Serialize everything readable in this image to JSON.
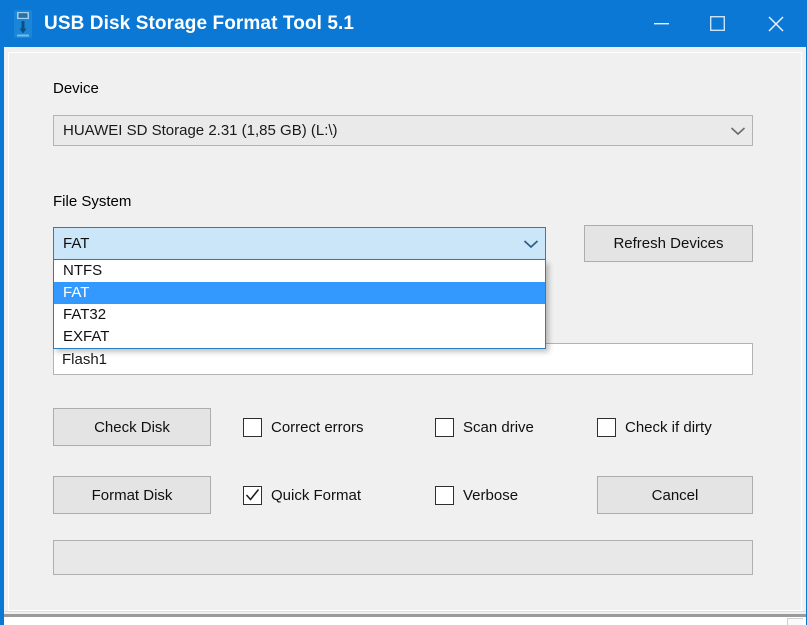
{
  "window": {
    "title": "USB Disk Storage Format Tool 5.1",
    "icon": "usb-drive-icon",
    "accent_color": "#0a78d4",
    "client_bg": "#f0f0f0",
    "controls": {
      "minimize": "minimize-icon",
      "maximize": "maximize-icon",
      "close": "close-icon"
    }
  },
  "form": {
    "device": {
      "label": "Device",
      "value": "HUAWEI  SD Storage  2.31 (1,85 GB) (L:\\)",
      "chevron": "chevron-down-icon"
    },
    "file_system": {
      "label": "File System",
      "value": "FAT",
      "chevron": "chevron-down-icon",
      "expanded": true,
      "options": [
        "NTFS",
        "FAT",
        "FAT32",
        "EXFAT"
      ],
      "selected_index": 1
    },
    "volume_label": {
      "value": "Flash1"
    },
    "refresh_button": "Refresh Devices",
    "check_row": {
      "button": "Check Disk",
      "checkboxes": [
        {
          "label": "Correct errors",
          "checked": false
        },
        {
          "label": "Scan drive",
          "checked": false
        },
        {
          "label": "Check if dirty",
          "checked": false
        }
      ]
    },
    "format_row": {
      "button": "Format Disk",
      "cancel_button": "Cancel",
      "checkboxes": [
        {
          "label": "Quick Format",
          "checked": true
        },
        {
          "label": "Verbose",
          "checked": false
        }
      ]
    },
    "status_bar": {
      "text": ""
    }
  },
  "colors": {
    "title_blue": "#0a78d4",
    "combo_open_bg": "#cbe5f9",
    "list_selection": "#3399ff",
    "button_face": "#e4e4e4"
  }
}
